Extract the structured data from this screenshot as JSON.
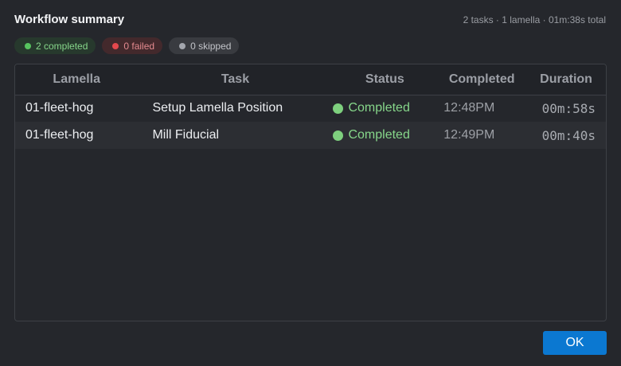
{
  "dialog": {
    "title": "Workflow summary",
    "summary": "2 tasks · 1 lamella · 01m:38s total"
  },
  "badges": {
    "completed": "2 completed",
    "failed": "0 failed",
    "skipped": "0 skipped"
  },
  "table": {
    "headers": {
      "lamella": "Lamella",
      "task": "Task",
      "status": "Status",
      "completed": "Completed",
      "duration": "Duration"
    },
    "rows": [
      {
        "lamella": "01-fleet-hog",
        "task": "Setup Lamella Position",
        "status": "Completed",
        "completed": "12:48PM",
        "duration": "00m:58s"
      },
      {
        "lamella": "01-fleet-hog",
        "task": "Mill Fiducial",
        "status": "Completed",
        "completed": "12:49PM",
        "duration": "00m:40s"
      }
    ]
  },
  "buttons": {
    "ok": "OK"
  },
  "colors": {
    "accent": "#0b78d1",
    "completed": "#7ed07e",
    "failed": "#e5484d",
    "skipped": "#a3a6ad"
  },
  "icons": {
    "status_completed": "green-dot-icon"
  }
}
